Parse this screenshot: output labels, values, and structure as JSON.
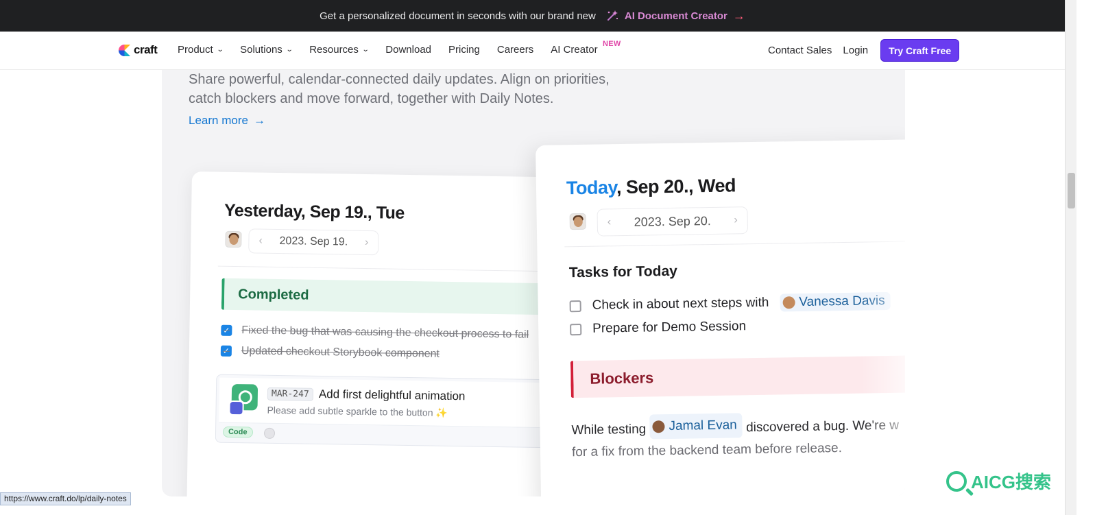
{
  "announcement": {
    "text": "Get a personalized document in seconds with our brand new",
    "link_label": "AI Document Creator",
    "link_arrow": "→",
    "icon": "magic-wand-sparkle-icon"
  },
  "nav": {
    "logo_text": "craft",
    "items": [
      {
        "label": "Product",
        "has_dropdown": true
      },
      {
        "label": "Solutions",
        "has_dropdown": true
      },
      {
        "label": "Resources",
        "has_dropdown": true
      },
      {
        "label": "Download",
        "has_dropdown": false
      },
      {
        "label": "Pricing",
        "has_dropdown": false
      },
      {
        "label": "Careers",
        "has_dropdown": false
      },
      {
        "label": "AI Creator",
        "has_dropdown": false,
        "badge": "NEW"
      }
    ],
    "contact_sales": "Contact Sales",
    "login": "Login",
    "cta": "Try Craft Free",
    "chevron": "⌄"
  },
  "hero": {
    "description_line1": "Share powerful, calendar-connected daily updates. Align on priorities,",
    "description_line2": "catch blockers and move forward, together with Daily Notes.",
    "learn_more": "Learn more",
    "learn_more_arrow": "→"
  },
  "yesterday": {
    "title": "Yesterday, Sep 19., Tue",
    "date_value": "2023. Sep 19.",
    "prev": "‹",
    "next": "›",
    "completed_heading": "Completed",
    "completed_items": [
      "Fixed the bug that was causing the checkout process to fail",
      "Updated checkout Storybook component"
    ],
    "check_mark": "✓",
    "issue": {
      "id": "MAR-247",
      "title": "Add first delightful animation",
      "description": "Please add subtle sparkle to the button ✨",
      "tag": "Code"
    }
  },
  "today": {
    "title_highlight": "Today",
    "title_rest": ", Sep 20., Wed",
    "date_value": "2023. Sep 20.",
    "prev": "‹",
    "next": "›",
    "tasks_heading": "Tasks for Today",
    "tasks": [
      {
        "text": "Check in about next steps with",
        "mention": "Vanessa Davis"
      },
      {
        "text": "Prepare for Demo Session",
        "mention": null
      }
    ],
    "blockers_heading": "Blockers",
    "blocker_text_before": "While testing",
    "blocker_mention": "Jamal Evan",
    "blocker_text_after": "discovered a bug. We're w",
    "blocker_text_line2": "for a fix from the backend team before release."
  },
  "statusbar": {
    "url": "https://www.craft.do/lp/daily-notes"
  },
  "watermark": {
    "text": "AICG搜索"
  },
  "colors": {
    "accent": "#1a84e5",
    "cta": "#6a3cf0",
    "completed_green": "#2aa36b",
    "blocker_red": "#d3213a",
    "new_badge": "#e047a8"
  }
}
